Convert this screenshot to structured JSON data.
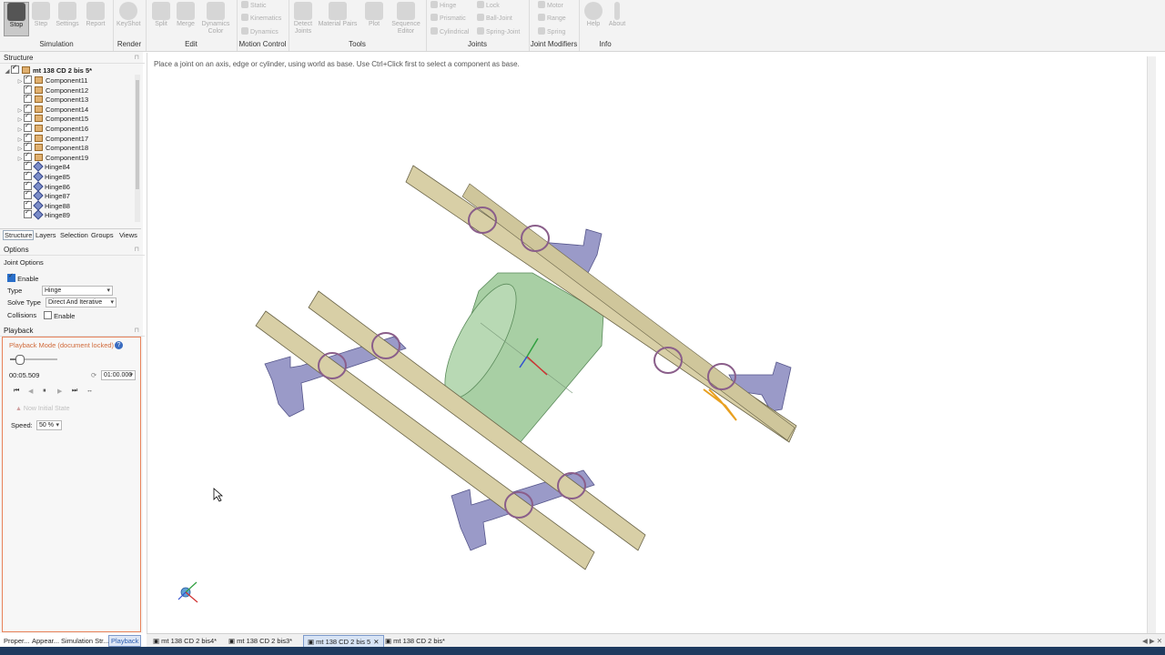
{
  "ribbon": {
    "simulation": {
      "label": "Simulation",
      "stop": "Stop",
      "step": "Step",
      "settings": "Settings",
      "report": "Report"
    },
    "render": {
      "label": "Render",
      "keyshot": "KeyShot"
    },
    "edit": {
      "label": "Edit",
      "split": "Split",
      "merge": "Merge",
      "dynamics_color": "Dynamics Color"
    },
    "motion_control": {
      "label": "Motion Control",
      "static": "Static",
      "kinematics": "Kinematics",
      "dynamics": "Dynamics"
    },
    "tools": {
      "label": "Tools",
      "detect_joints": "Detect Joints",
      "material_pairs": "Material Pairs",
      "plot": "Plot",
      "sequence_editor": "Sequence Editor"
    },
    "joints": {
      "label": "Joints",
      "hinge": "Hinge",
      "prismatic": "Prismatic",
      "cylindrical": "Cylindrical",
      "lock": "Lock",
      "ball_joint": "Ball-Joint",
      "spring_joint": "Spring-Joint"
    },
    "joint_modifiers": {
      "label": "Joint Modifiers",
      "motor": "Motor",
      "range": "Range",
      "spring": "Spring"
    },
    "info": {
      "label": "Info",
      "help": "Help",
      "about": "About"
    }
  },
  "structure": {
    "title": "Structure",
    "root": "mt 138 CD 2 bis 5*",
    "items": [
      {
        "label": "Component11",
        "kind": "comp",
        "expand": "▷"
      },
      {
        "label": "Component12",
        "kind": "comp",
        "expand": ""
      },
      {
        "label": "Component13",
        "kind": "comp",
        "expand": ""
      },
      {
        "label": "Component14",
        "kind": "comp",
        "expand": "▷"
      },
      {
        "label": "Component15",
        "kind": "comp",
        "expand": "▷"
      },
      {
        "label": "Component16",
        "kind": "comp",
        "expand": "▷"
      },
      {
        "label": "Component17",
        "kind": "comp",
        "expand": "▷"
      },
      {
        "label": "Component18",
        "kind": "comp",
        "expand": "▷"
      },
      {
        "label": "Component19",
        "kind": "comp",
        "expand": "▷"
      },
      {
        "label": "Hinge84",
        "kind": "hinge",
        "expand": ""
      },
      {
        "label": "Hinge85",
        "kind": "hinge",
        "expand": ""
      },
      {
        "label": "Hinge86",
        "kind": "hinge",
        "expand": ""
      },
      {
        "label": "Hinge87",
        "kind": "hinge",
        "expand": ""
      },
      {
        "label": "Hinge88",
        "kind": "hinge",
        "expand": ""
      },
      {
        "label": "Hinge89",
        "kind": "hinge",
        "expand": ""
      }
    ],
    "tabs": [
      "Structure",
      "Layers",
      "Selection",
      "Groups",
      "Views"
    ]
  },
  "options": {
    "title": "Options",
    "section": "Joint Options",
    "enable_label": "Enable",
    "type_label": "Type",
    "type_value": "Hinge",
    "solve_label": "Solve Type",
    "solve_value": "Direct And Iterative",
    "collisions_label": "Collisions",
    "collisions_enable": "Enable"
  },
  "playback": {
    "title": "Playback",
    "mode": "Playback Mode (document locked)",
    "current_time": "00:05.509",
    "end_time": "01:00.000",
    "slider_fraction": 0.2,
    "initial_state": "Now Initial State",
    "speed_label": "Speed:",
    "speed_value": "50 %"
  },
  "bottom_panel_tabs": [
    "Proper...",
    "Appear...",
    "Simulation Str...",
    "Playback"
  ],
  "viewport": {
    "hint": "Place a joint on an axis, edge or cylinder, using world as base. Use Ctrl+Click first to select a component as base."
  },
  "doc_tabs": [
    "mt 138 CD 2 bis4*",
    "mt 138 CD 2 bis3*",
    "mt 138 CD 2 bis 5",
    "mt 138 CD 2 bis*"
  ],
  "colors": {
    "beam": "#d8cfa6",
    "block": "#9a9ac8",
    "cylinder": "#a8cfa4",
    "hinge_ring": "#8a5e8a",
    "accent_selection": "#e8a020",
    "status_bar": "#1e3a5f"
  }
}
